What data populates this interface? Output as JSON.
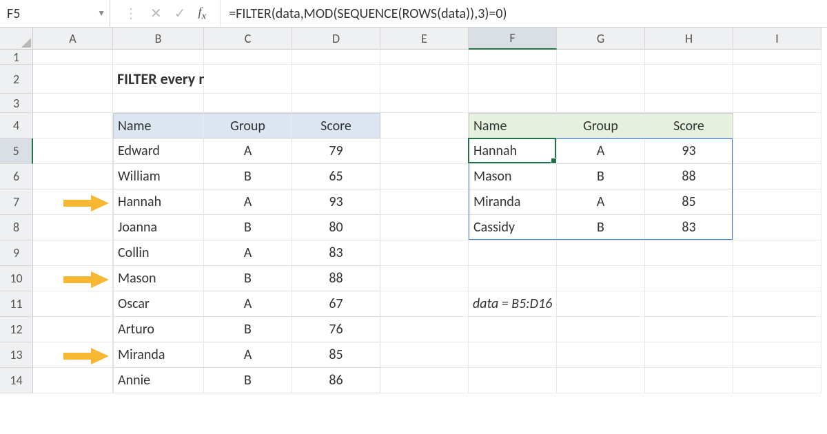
{
  "name_box": "F5",
  "formula": "=FILTER(data,MOD(SEQUENCE(ROWS(data)),3)=0)",
  "column_letters": [
    "A",
    "B",
    "C",
    "D",
    "E",
    "F",
    "G",
    "H",
    "I"
  ],
  "row_numbers": [
    1,
    2,
    3,
    4,
    5,
    6,
    7,
    8,
    9,
    10,
    11,
    12,
    13,
    14
  ],
  "title": "FILTER every nth row",
  "source_headers": {
    "name": "Name",
    "group": "Group",
    "score": "Score"
  },
  "source_data": [
    {
      "name": "Edward",
      "group": "A",
      "score": "79"
    },
    {
      "name": "William",
      "group": "B",
      "score": "65"
    },
    {
      "name": "Hannah",
      "group": "A",
      "score": "93"
    },
    {
      "name": "Joanna",
      "group": "B",
      "score": "80"
    },
    {
      "name": "Collin",
      "group": "A",
      "score": "83"
    },
    {
      "name": "Mason",
      "group": "B",
      "score": "88"
    },
    {
      "name": "Oscar",
      "group": "A",
      "score": "67"
    },
    {
      "name": "Arturo",
      "group": "B",
      "score": "76"
    },
    {
      "name": "Miranda",
      "group": "A",
      "score": "85"
    },
    {
      "name": "Annie",
      "group": "B",
      "score": "86"
    }
  ],
  "result_headers": {
    "name": "Name",
    "group": "Group",
    "score": "Score"
  },
  "result_data": [
    {
      "name": "Hannah",
      "group": "A",
      "score": "93"
    },
    {
      "name": "Mason",
      "group": "B",
      "score": "88"
    },
    {
      "name": "Miranda",
      "group": "A",
      "score": "85"
    },
    {
      "name": "Cassidy",
      "group": "B",
      "score": "83"
    }
  ],
  "annotation": "data = B5:D16",
  "arrow_rows": [
    7,
    10,
    13
  ],
  "active_col": "F",
  "active_row": 5,
  "chart_data": {
    "type": "table",
    "source": {
      "headers": [
        "Name",
        "Group",
        "Score"
      ],
      "rows": [
        [
          "Edward",
          "A",
          79
        ],
        [
          "William",
          "B",
          65
        ],
        [
          "Hannah",
          "A",
          93
        ],
        [
          "Joanna",
          "B",
          80
        ],
        [
          "Collin",
          "A",
          83
        ],
        [
          "Mason",
          "B",
          88
        ],
        [
          "Oscar",
          "A",
          67
        ],
        [
          "Arturo",
          "B",
          76
        ],
        [
          "Miranda",
          "A",
          85
        ],
        [
          "Annie",
          "B",
          86
        ]
      ]
    },
    "result": {
      "headers": [
        "Name",
        "Group",
        "Score"
      ],
      "rows": [
        [
          "Hannah",
          "A",
          93
        ],
        [
          "Mason",
          "B",
          88
        ],
        [
          "Miranda",
          "A",
          85
        ],
        [
          "Cassidy",
          "B",
          83
        ]
      ]
    }
  }
}
